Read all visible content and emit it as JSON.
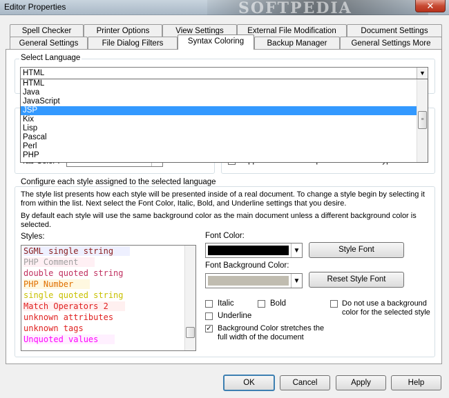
{
  "window": {
    "title": "Editor Properties",
    "watermark": "SOFTPEDIA",
    "close_glyph": "✕"
  },
  "tabs": {
    "row1": [
      "Spell Checker",
      "Printer Options",
      "View Settings",
      "External File Modification",
      "Document Settings"
    ],
    "row2": [
      "General Settings",
      "File Dialog Filters",
      "Syntax Coloring",
      "Backup Manager",
      "General Settings More"
    ],
    "active": "Syntax Coloring"
  },
  "language": {
    "group_label": "Select Language",
    "selected": "HTML",
    "options": [
      "HTML",
      "Java",
      "JavaScript",
      "JSP",
      "Kix",
      "Lisp",
      "Pascal",
      "Perl",
      "PHP"
    ],
    "highlighted": "JSP",
    "partial_label": "Tab Color :",
    "partial_checkbox_label": "Support auto text completion for this file type"
  },
  "configure": {
    "group_label": "Configure each style assigned to the selected language",
    "para1": "The style list presents how each style will be presented inside of a real document.  To change a style begin by selecting it from within the list.  Next select the Font Color, Italic, Bold, and Underline settings that you desire.",
    "para2": "By default each style will use the same background color as the main document unless a different background color is selected.",
    "styles_label": "Styles:",
    "styles": [
      {
        "text": "SGML single string",
        "color": "#8b2020",
        "bg": "#eef0ff"
      },
      {
        "text": "PHP Comment",
        "color": "#a0a0a0",
        "bg": "#fff0f4"
      },
      {
        "text": "double quoted string",
        "color": "#c03060",
        "bg": "#ffffff"
      },
      {
        "text": "PHP Number",
        "color": "#e07000",
        "bg": "#fff8e0"
      },
      {
        "text": "single quoted string",
        "color": "#c8c000",
        "bg": "#ffffff"
      },
      {
        "text": "Match Operators 2",
        "color": "#e02020",
        "bg": "#fff0f0"
      },
      {
        "text": "unknown attributes",
        "color": "#e02020",
        "bg": "#ffffff"
      },
      {
        "text": "unknown tags",
        "color": "#e02020",
        "bg": "#ffffff"
      },
      {
        "text": "Unquoted values",
        "color": "#ff00ff",
        "bg": "#fff0ff"
      }
    ],
    "font_color_label": "Font Color:",
    "font_color_value": "#000000",
    "font_bg_label": "Font Background Color:",
    "font_bg_value": "#c0bcb0",
    "style_font_button": "Style Font",
    "reset_style_font_button": "Reset Style Font",
    "italic_label": "Italic",
    "bold_label": "Bold",
    "underline_label": "Underline",
    "no_bg_label": "Do not use a background color for the selected style",
    "bg_stretch_label": "Background Color stretches the full width of the document",
    "bg_stretch_checked": "✓"
  },
  "footer": {
    "ok": "OK",
    "cancel": "Cancel",
    "apply": "Apply",
    "help": "Help"
  }
}
